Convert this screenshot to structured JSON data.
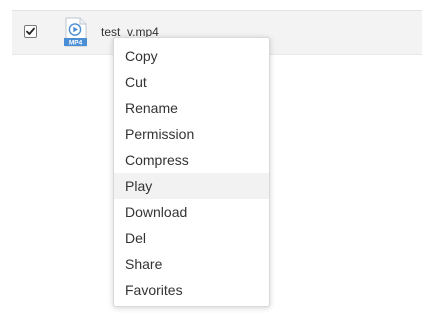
{
  "file": {
    "name": "test_v.mp4",
    "icon": "mp4-video-file-icon",
    "icon_badge": "MP4",
    "checked": true
  },
  "context_menu": {
    "highlighted_index": 6,
    "items": [
      {
        "label": "Copy"
      },
      {
        "label": "Cut"
      },
      {
        "label": "Rename"
      },
      {
        "label": "Permission"
      },
      {
        "label": "Compress"
      },
      {
        "label": "Play"
      },
      {
        "label": "Download"
      },
      {
        "label": "Del"
      },
      {
        "label": "Share"
      },
      {
        "label": "Favorites"
      }
    ]
  },
  "colors": {
    "row_background": "#f3f3f3",
    "icon_blue": "#4a8fd6",
    "menu_hover": "#f2f2f2",
    "text": "#333333"
  }
}
